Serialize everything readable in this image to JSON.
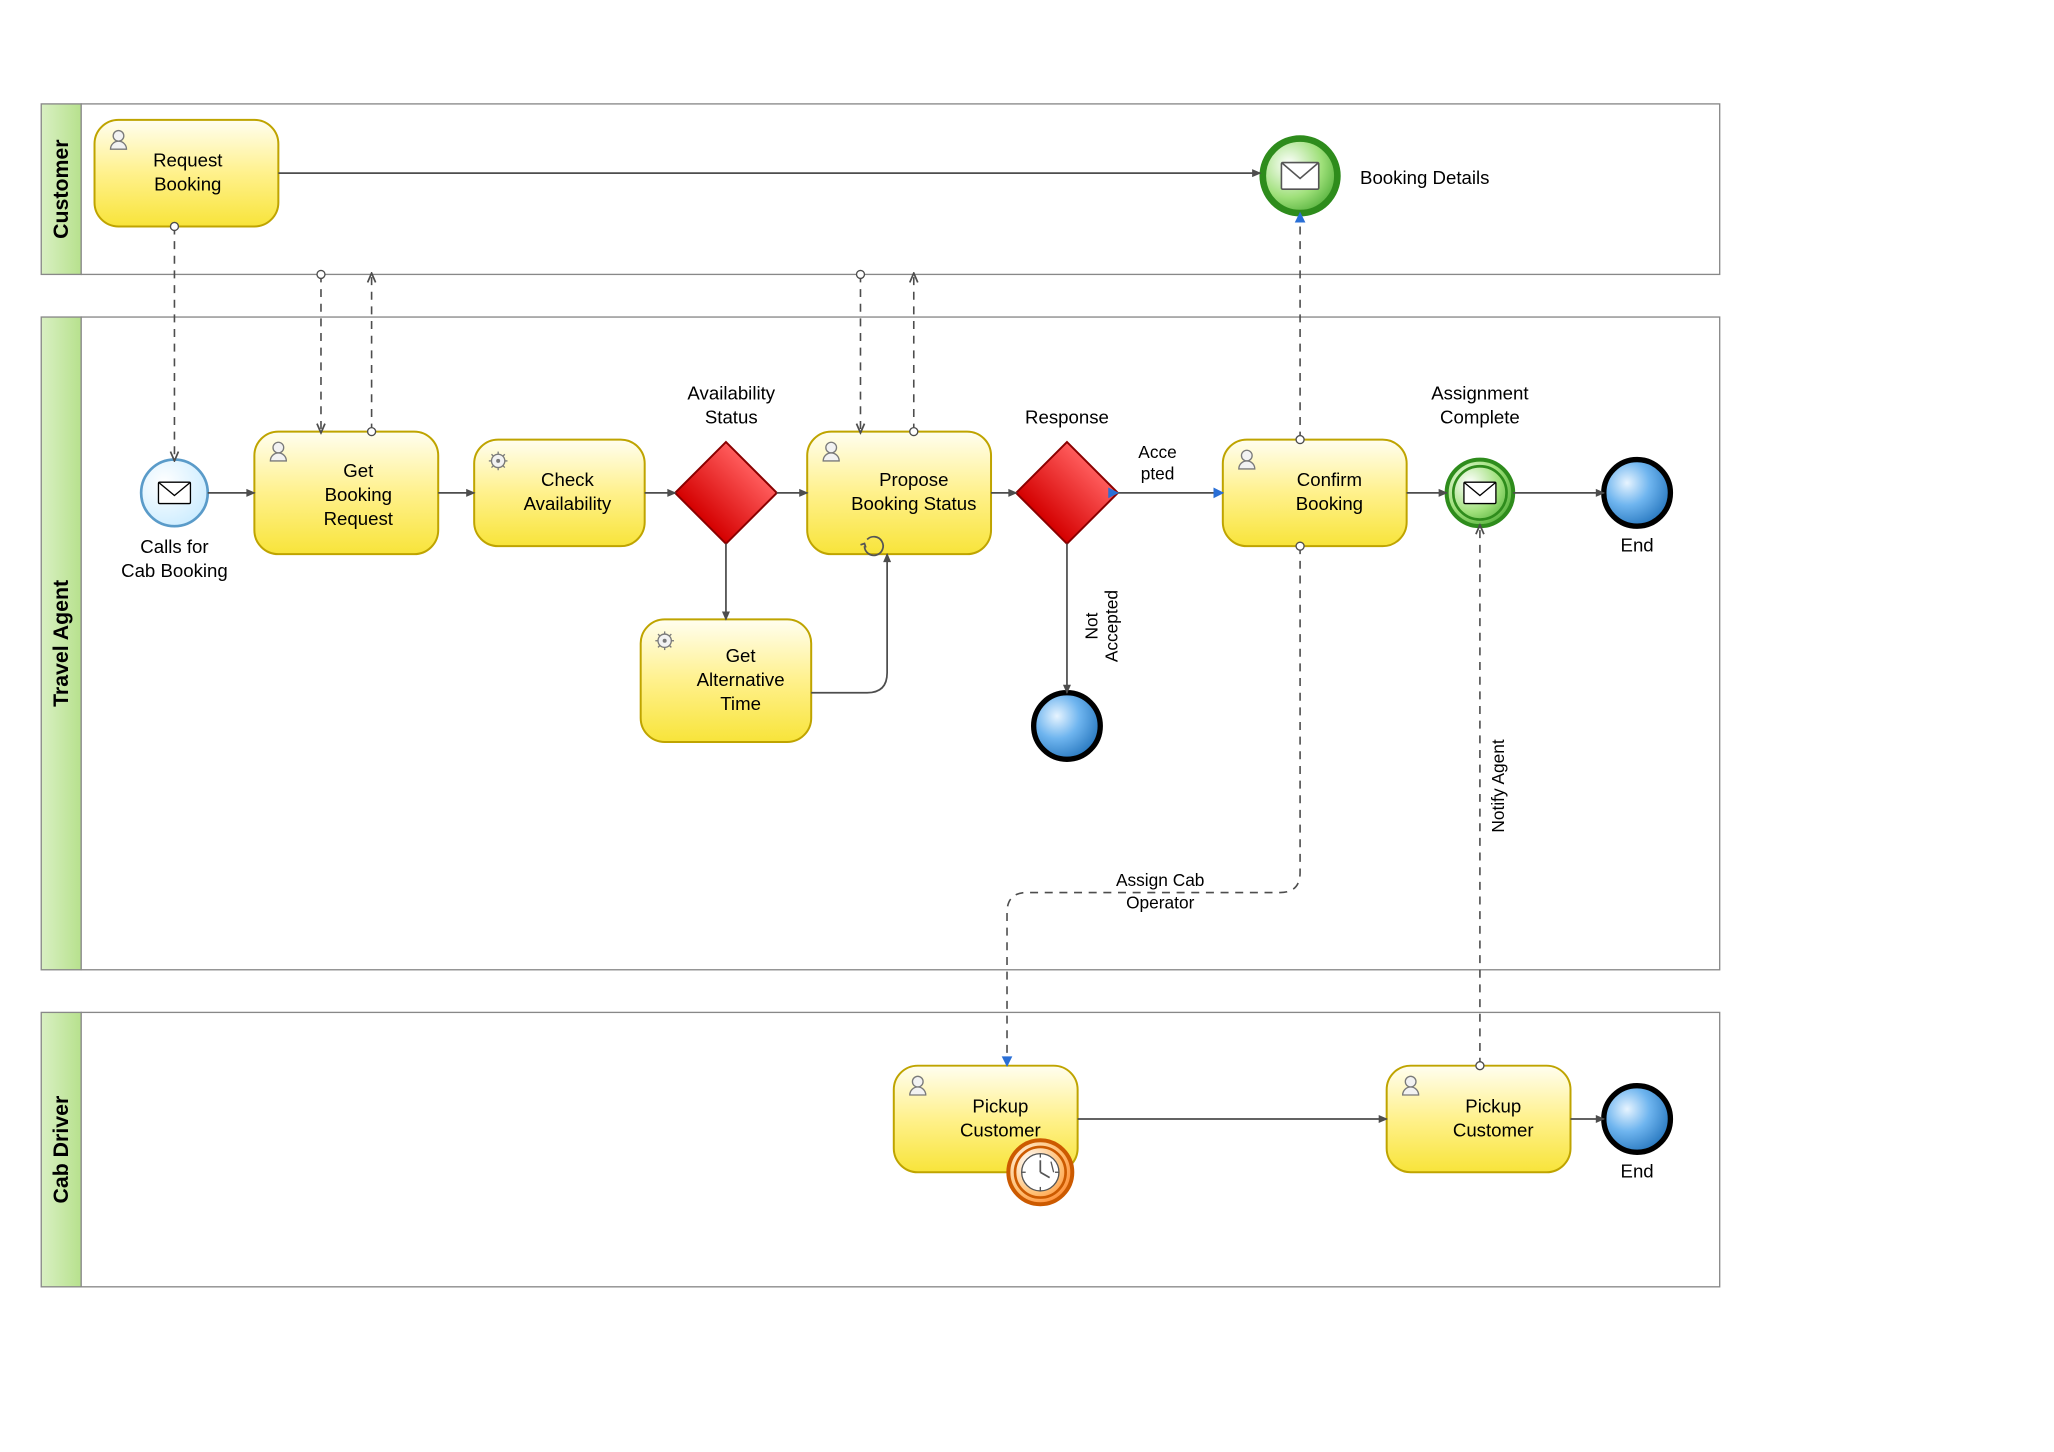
{
  "lanes": {
    "customer": "Customer",
    "travel_agent": "Travel Agent",
    "cab_driver": "Cab Driver"
  },
  "tasks": {
    "request_booking_l1": "Request",
    "request_booking_l2": "Booking",
    "get_booking_request_l1": "Get",
    "get_booking_request_l2": "Booking",
    "get_booking_request_l3": "Request",
    "check_availability_l1": "Check",
    "check_availability_l2": "Availability",
    "propose_booking_l1": "Propose",
    "propose_booking_l2": "Booking Status",
    "get_alt_time_l1": "Get",
    "get_alt_time_l2": "Alternative",
    "get_alt_time_l3": "Time",
    "confirm_booking_l1": "Confirm",
    "confirm_booking_l2": "Booking",
    "pickup_customer_l1": "Pickup",
    "pickup_customer_l2": "Customer",
    "pickup_customer2_l1": "Pickup",
    "pickup_customer2_l2": "Customer"
  },
  "labels": {
    "calls_for_l1": "Calls for",
    "calls_for_l2": "Cab Booking",
    "availability_status_l1": "Availability",
    "availability_status_l2": "Status",
    "response": "Response",
    "accepted_l1": "Acce",
    "accepted_l2": "pted",
    "not_accepted_l1": "Not",
    "not_accepted_l2": "Accepted",
    "assignment_complete_l1": "Assignment",
    "assignment_complete_l2": "Complete",
    "booking_details": "Booking Details",
    "end1": "End",
    "end2": "End",
    "assign_cab_l1": "Assign Cab",
    "assign_cab_l2": "Operator",
    "notify_agent": "Notify Agent"
  }
}
